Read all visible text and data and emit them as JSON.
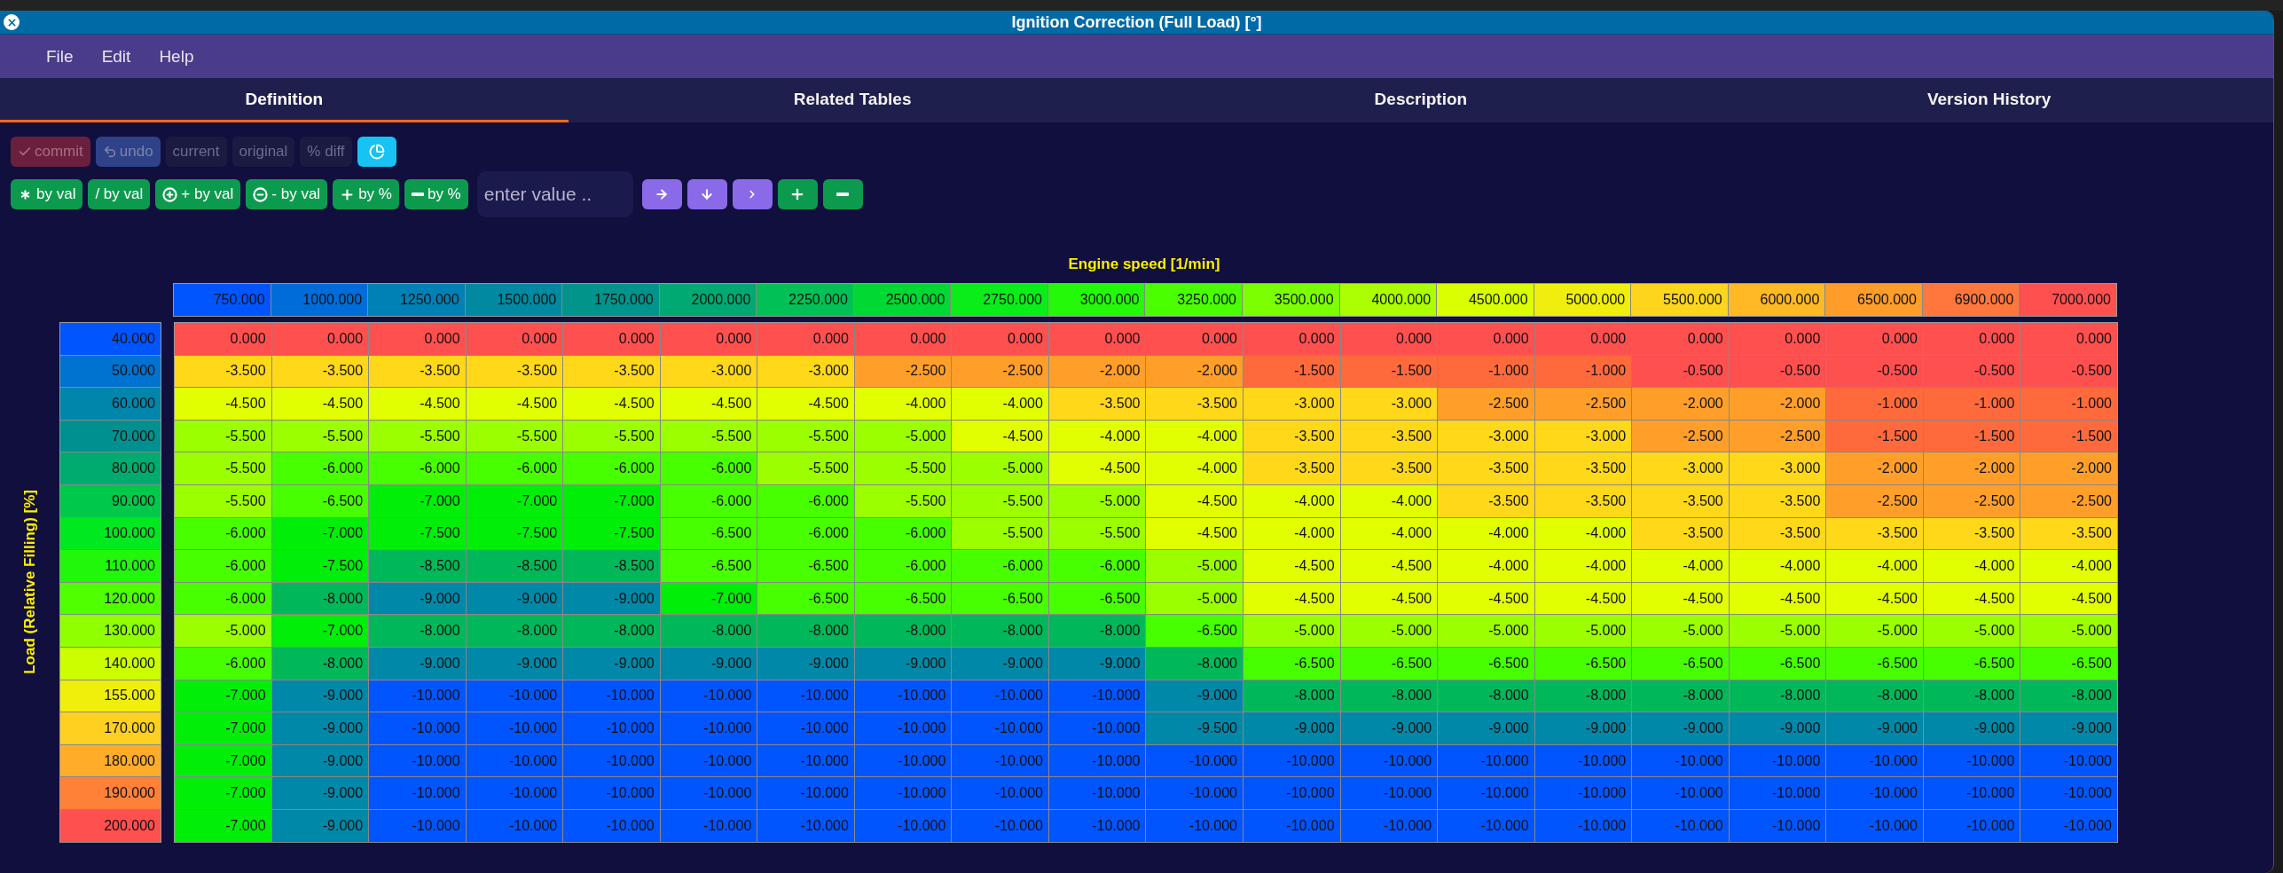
{
  "window": {
    "title": "Ignition Correction (Full Load) [°]"
  },
  "menu": [
    "File",
    "Edit",
    "Help"
  ],
  "tabs": [
    {
      "label": "Definition",
      "selected": true
    },
    {
      "label": "Related Tables",
      "selected": false
    },
    {
      "label": "Description",
      "selected": false
    },
    {
      "label": "Version History",
      "selected": false
    }
  ],
  "toolbar_top": [
    {
      "label": "commit",
      "kind": "danger",
      "disabled": true
    },
    {
      "label": "undo",
      "kind": "primary",
      "disabled": true
    },
    {
      "label": "current",
      "kind": "ghost",
      "disabled": true
    },
    {
      "label": "original",
      "kind": "ghost",
      "disabled": true
    },
    {
      "label": "% diff",
      "kind": "ghost",
      "disabled": true
    },
    {
      "kind": "accent",
      "disabled": false
    }
  ],
  "toolbar_ops": [
    "by val",
    "/ by val",
    "+ by val",
    "- by val",
    "by %",
    "by %"
  ],
  "value_field": {
    "placeholder": "enter value .."
  },
  "table": {
    "x_axis_title": "Engine speed [1/min]",
    "y_axis_title": "Load (Relative Filling) [%]",
    "columns": [
      "750.000",
      "1000.000",
      "1250.000",
      "1500.000",
      "1750.000",
      "2000.000",
      "2250.000",
      "2500.000",
      "2750.000",
      "3000.000",
      "3250.000",
      "3500.000",
      "4000.000",
      "4500.000",
      "5000.000",
      "5500.000",
      "6000.000",
      "6500.000",
      "6900.000",
      "7000.000"
    ],
    "rows": [
      {
        "label": "40.000",
        "values": [
          "0.000",
          "0.000",
          "0.000",
          "0.000",
          "0.000",
          "0.000",
          "0.000",
          "0.000",
          "0.000",
          "0.000",
          "0.000",
          "0.000",
          "0.000",
          "0.000",
          "0.000",
          "0.000",
          "0.000",
          "0.000",
          "0.000",
          "0.000"
        ]
      },
      {
        "label": "50.000",
        "values": [
          "-3.500",
          "-3.500",
          "-3.500",
          "-3.500",
          "-3.500",
          "-3.000",
          "-3.000",
          "-2.500",
          "-2.500",
          "-2.000",
          "-2.000",
          "-1.500",
          "-1.500",
          "-1.000",
          "-1.000",
          "-0.500",
          "-0.500",
          "-0.500",
          "-0.500",
          "-0.500"
        ]
      },
      {
        "label": "60.000",
        "values": [
          "-4.500",
          "-4.500",
          "-4.500",
          "-4.500",
          "-4.500",
          "-4.500",
          "-4.500",
          "-4.000",
          "-4.000",
          "-3.500",
          "-3.500",
          "-3.000",
          "-3.000",
          "-2.500",
          "-2.500",
          "-2.000",
          "-2.000",
          "-1.000",
          "-1.000",
          "-1.000"
        ]
      },
      {
        "label": "70.000",
        "values": [
          "-5.500",
          "-5.500",
          "-5.500",
          "-5.500",
          "-5.500",
          "-5.500",
          "-5.500",
          "-5.000",
          "-4.500",
          "-4.000",
          "-4.000",
          "-3.500",
          "-3.500",
          "-3.000",
          "-3.000",
          "-2.500",
          "-2.500",
          "-1.500",
          "-1.500",
          "-1.500"
        ]
      },
      {
        "label": "80.000",
        "values": [
          "-5.500",
          "-6.000",
          "-6.000",
          "-6.000",
          "-6.000",
          "-6.000",
          "-5.500",
          "-5.500",
          "-5.000",
          "-4.500",
          "-4.000",
          "-3.500",
          "-3.500",
          "-3.500",
          "-3.500",
          "-3.000",
          "-3.000",
          "-2.000",
          "-2.000",
          "-2.000"
        ]
      },
      {
        "label": "90.000",
        "values": [
          "-5.500",
          "-6.500",
          "-7.000",
          "-7.000",
          "-7.000",
          "-6.000",
          "-6.000",
          "-5.500",
          "-5.500",
          "-5.000",
          "-4.500",
          "-4.000",
          "-4.000",
          "-3.500",
          "-3.500",
          "-3.500",
          "-3.500",
          "-2.500",
          "-2.500",
          "-2.500"
        ]
      },
      {
        "label": "100.000",
        "values": [
          "-6.000",
          "-7.000",
          "-7.500",
          "-7.500",
          "-7.500",
          "-6.500",
          "-6.000",
          "-6.000",
          "-5.500",
          "-5.500",
          "-4.500",
          "-4.000",
          "-4.000",
          "-4.000",
          "-4.000",
          "-3.500",
          "-3.500",
          "-3.500",
          "-3.500",
          "-3.500"
        ]
      },
      {
        "label": "110.000",
        "values": [
          "-6.000",
          "-7.500",
          "-8.500",
          "-8.500",
          "-8.500",
          "-6.500",
          "-6.500",
          "-6.000",
          "-6.000",
          "-6.000",
          "-5.000",
          "-4.500",
          "-4.500",
          "-4.000",
          "-4.000",
          "-4.000",
          "-4.000",
          "-4.000",
          "-4.000",
          "-4.000"
        ]
      },
      {
        "label": "120.000",
        "values": [
          "-6.000",
          "-8.000",
          "-9.000",
          "-9.000",
          "-9.000",
          "-7.000",
          "-6.500",
          "-6.500",
          "-6.500",
          "-6.500",
          "-5.000",
          "-4.500",
          "-4.500",
          "-4.500",
          "-4.500",
          "-4.500",
          "-4.500",
          "-4.500",
          "-4.500",
          "-4.500"
        ]
      },
      {
        "label": "130.000",
        "values": [
          "-5.000",
          "-7.000",
          "-8.000",
          "-8.000",
          "-8.000",
          "-8.000",
          "-8.000",
          "-8.000",
          "-8.000",
          "-8.000",
          "-6.500",
          "-5.000",
          "-5.000",
          "-5.000",
          "-5.000",
          "-5.000",
          "-5.000",
          "-5.000",
          "-5.000",
          "-5.000"
        ]
      },
      {
        "label": "140.000",
        "values": [
          "-6.000",
          "-8.000",
          "-9.000",
          "-9.000",
          "-9.000",
          "-9.000",
          "-9.000",
          "-9.000",
          "-9.000",
          "-9.000",
          "-8.000",
          "-6.500",
          "-6.500",
          "-6.500",
          "-6.500",
          "-6.500",
          "-6.500",
          "-6.500",
          "-6.500",
          "-6.500"
        ]
      },
      {
        "label": "155.000",
        "values": [
          "-7.000",
          "-9.000",
          "-10.000",
          "-10.000",
          "-10.000",
          "-10.000",
          "-10.000",
          "-10.000",
          "-10.000",
          "-10.000",
          "-9.000",
          "-8.000",
          "-8.000",
          "-8.000",
          "-8.000",
          "-8.000",
          "-8.000",
          "-8.000",
          "-8.000",
          "-8.000"
        ]
      },
      {
        "label": "170.000",
        "values": [
          "-7.000",
          "-9.000",
          "-10.000",
          "-10.000",
          "-10.000",
          "-10.000",
          "-10.000",
          "-10.000",
          "-10.000",
          "-10.000",
          "-9.500",
          "-9.000",
          "-9.000",
          "-9.000",
          "-9.000",
          "-9.000",
          "-9.000",
          "-9.000",
          "-9.000",
          "-9.000"
        ]
      },
      {
        "label": "180.000",
        "values": [
          "-7.000",
          "-9.000",
          "-10.000",
          "-10.000",
          "-10.000",
          "-10.000",
          "-10.000",
          "-10.000",
          "-10.000",
          "-10.000",
          "-10.000",
          "-10.000",
          "-10.000",
          "-10.000",
          "-10.000",
          "-10.000",
          "-10.000",
          "-10.000",
          "-10.000",
          "-10.000"
        ]
      },
      {
        "label": "190.000",
        "values": [
          "-7.000",
          "-9.000",
          "-10.000",
          "-10.000",
          "-10.000",
          "-10.000",
          "-10.000",
          "-10.000",
          "-10.000",
          "-10.000",
          "-10.000",
          "-10.000",
          "-10.000",
          "-10.000",
          "-10.000",
          "-10.000",
          "-10.000",
          "-10.000",
          "-10.000",
          "-10.000"
        ]
      },
      {
        "label": "200.000",
        "values": [
          "-7.000",
          "-9.000",
          "-10.000",
          "-10.000",
          "-10.000",
          "-10.000",
          "-10.000",
          "-10.000",
          "-10.000",
          "-10.000",
          "-10.000",
          "-10.000",
          "-10.000",
          "-10.000",
          "-10.000",
          "-10.000",
          "-10.000",
          "-10.000",
          "-10.000",
          "-10.000"
        ]
      }
    ]
  }
}
